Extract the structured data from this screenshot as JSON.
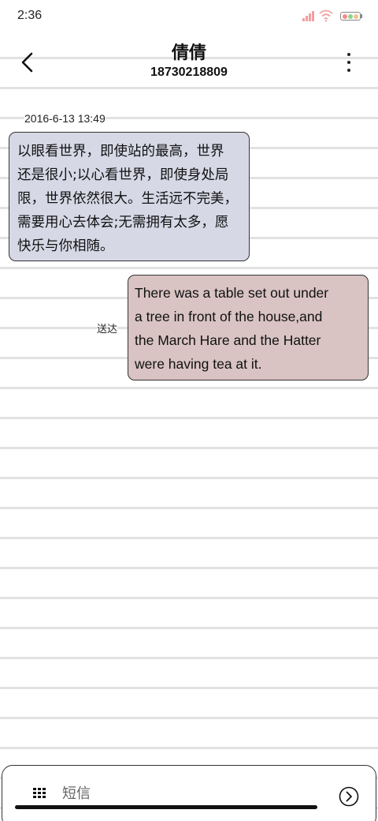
{
  "status_bar": {
    "time": "2:36",
    "icons": [
      "signal-icon",
      "wifi-icon",
      "battery-icon"
    ],
    "colors": {
      "signal": "#f1a0a0",
      "wifi": "#f1a0a0",
      "battery_dots": [
        "#f28b8b",
        "#8fd18f",
        "#f2c28b"
      ]
    }
  },
  "header": {
    "back_icon": "chevron-left-icon",
    "contact_name": "倩倩",
    "contact_number": "18730218809",
    "more_icon": "more-vertical-icon"
  },
  "conversation": {
    "timestamp": "2016-6-13 13:49",
    "messages": [
      {
        "direction": "received",
        "lines": [
          "以眼看世界，即使站的最高，世界",
          "还是很小;以心看世界，即使身处局",
          "限，世界依然很大。生活远不完美，",
          "需要用心去体会;无需拥有太多，愿",
          "快乐与你相随。"
        ],
        "bubble_color": "#d6d8e6"
      },
      {
        "direction": "sent",
        "status": "送达",
        "lines": [
          "There was a table set out under",
          "a tree in front of the house,and",
          "the March Hare and the Hatter",
          "were having tea at it."
        ],
        "bubble_color": "#d9c3c3"
      }
    ]
  },
  "composer": {
    "apps_icon": "grid-icon",
    "placeholder": "短信",
    "value": "",
    "send_icon": "send-circle-icon"
  },
  "theme": {
    "background": "#ffffff",
    "ruled_line": "#e2e2e2"
  }
}
